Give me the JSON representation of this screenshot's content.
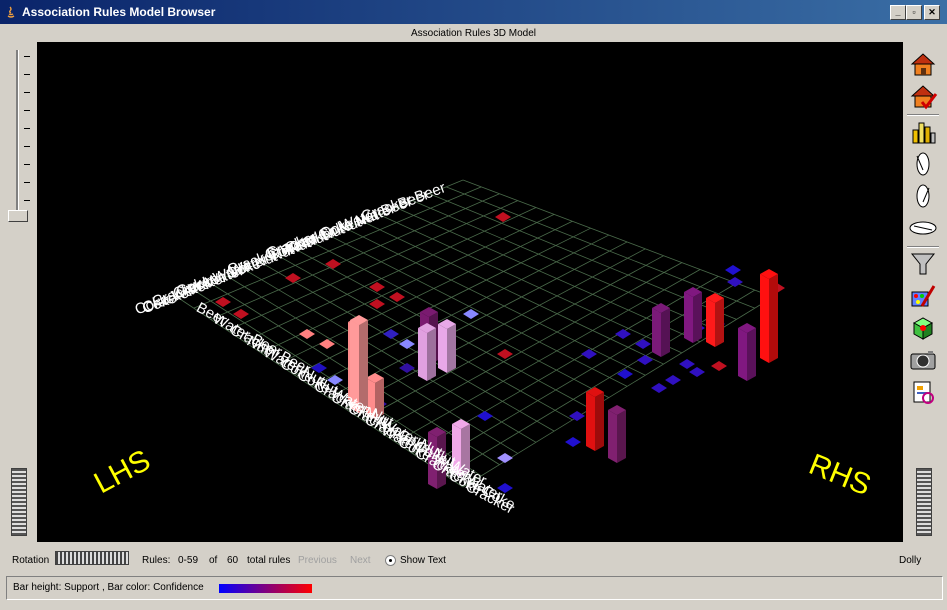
{
  "window": {
    "title": "Association Rules Model Browser",
    "minimize_glyph": "_",
    "maximize_glyph": "▫",
    "close_glyph": "✕"
  },
  "canvas": {
    "subtitle": "Association Rules 3D Model",
    "axis_lhs": "LHS",
    "axis_rhs": "RHS",
    "lhs_items": [
      "Cracker Beer",
      "Beer",
      "Water Beer",
      "Cracker Coke Water",
      "Cracker Coke Nut",
      "Cracker Nut",
      "Cracker Water Nut",
      "Coke Nut",
      "Nut",
      "Water Nut",
      "Coke Water Nut",
      "Cracker Coke",
      "Cracker Water",
      "Water",
      "Coke Water",
      "Cracker",
      "Coke"
    ],
    "rhs_items": [
      "Beer",
      "Water Beer",
      "Cracker Beer",
      "Nut",
      "Water Nut",
      "Coke Nut",
      "Coke Water Nut",
      "Cracker Nut",
      "Cracker Water Nut",
      "Cracker Coke Nut",
      "Cracker Coke Water",
      "Water",
      "Coke Water",
      "Cracker Water",
      "Cracker Coke",
      "Coke",
      "Cracker"
    ]
  },
  "toolbar": {
    "icons": [
      "house-icon",
      "house-check-icon",
      "bar-chart-icon",
      "rotate-x-icon",
      "rotate-y-icon",
      "rotate-z-icon",
      "funnel-icon",
      "palette-tools-icon",
      "cube-icon",
      "camera-icon",
      "print-preview-icon"
    ]
  },
  "controls": {
    "rotation_label": "Rotation",
    "rules_label": "Rules:",
    "rules_range": "0-59",
    "rules_of": "of",
    "rules_total": "60",
    "rules_suffix": "total rules",
    "previous_label": "Previous",
    "next_label": "Next",
    "show_text_label": "Show Text",
    "dolly_label": "Dolly"
  },
  "status": {
    "legend_text": "Bar height: Support , Bar color: Confidence",
    "gradient_colors": [
      "#0000ff",
      "#ff0000"
    ]
  }
}
